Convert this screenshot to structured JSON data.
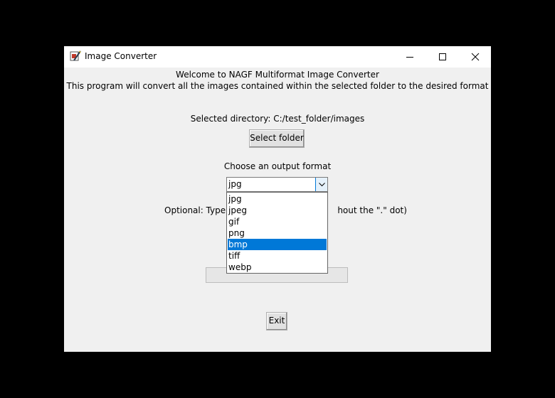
{
  "window": {
    "title": "Image Converter"
  },
  "header": {
    "welcome": "Welcome to NAGF Multiformat Image Converter",
    "description": "This program will convert all the images contained within the selected folder to the desired format"
  },
  "directory": {
    "text": "Selected directory: C:/test_folder/images"
  },
  "select_folder_button": "Select folder",
  "format": {
    "label": "Choose an output format",
    "selected": "jpg",
    "options": [
      "jpg",
      "jpeg",
      "gif",
      "png",
      "bmp",
      "tiff",
      "webp"
    ],
    "highlighted": "bmp"
  },
  "optional": {
    "text_left": "Optional: Type a",
    "text_right": "hout the \".\" dot)"
  },
  "exit_button": "Exit",
  "colors": {
    "highlight": "#0078d7",
    "window_bg": "#f0f0f0"
  }
}
